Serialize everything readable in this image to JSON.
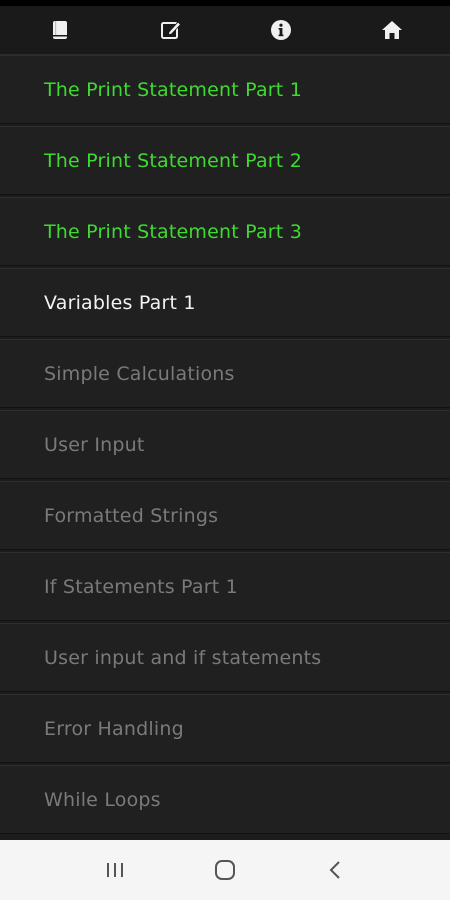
{
  "toolbar": {
    "icons": [
      "book-icon",
      "edit-icon",
      "info-icon",
      "home-icon"
    ]
  },
  "lessons": [
    {
      "label": "The Print Statement Part 1",
      "state": "done"
    },
    {
      "label": "The Print Statement Part 2",
      "state": "done"
    },
    {
      "label": "The Print Statement Part 3",
      "state": "done"
    },
    {
      "label": "Variables Part 1",
      "state": "current"
    },
    {
      "label": "Simple Calculations",
      "state": "locked"
    },
    {
      "label": "User Input",
      "state": "locked"
    },
    {
      "label": "Formatted Strings",
      "state": "locked"
    },
    {
      "label": "If Statements Part 1",
      "state": "locked"
    },
    {
      "label": "User input and if statements",
      "state": "locked"
    },
    {
      "label": "Error Handling",
      "state": "locked"
    },
    {
      "label": "While Loops",
      "state": "locked"
    }
  ],
  "colors": {
    "done": "#3ddb2f",
    "current": "#f2f2f2",
    "locked": "#7a7a7a",
    "background": "#1c1c1c"
  },
  "navbar": {
    "icons": [
      "recent-apps-icon",
      "home-button-icon",
      "back-icon"
    ]
  }
}
